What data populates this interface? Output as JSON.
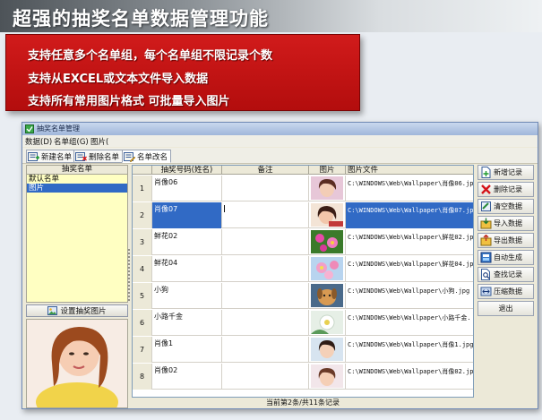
{
  "headline": "超强的抽奖名单数据管理功能",
  "promo": {
    "line1": "支持任意多个名单组，每个名单组不限记录个数",
    "line2": "支持从EXCEL或文本文件导入数据",
    "line3": "支持所有常用图片格式 可批量导入图片"
  },
  "window": {
    "title": "抽奖名单管理",
    "menu": [
      "数据(D)",
      "名单组(G)",
      "图片("
    ],
    "toolbar": {
      "new": "新建名单",
      "delete": "删除名单",
      "rename": "名单改名"
    }
  },
  "left_panel": {
    "header": "抽奖名单",
    "items": [
      "默认名单",
      "图片"
    ],
    "selected_index": 1,
    "set_photo_button": "设置抽奖图片"
  },
  "grid": {
    "columns": [
      "抽奖号码(姓名)",
      "备注",
      "图片",
      "图片文件"
    ],
    "rows": [
      {
        "num": "1",
        "name": "肖像06",
        "note": "",
        "file": "C:\\WINDOWS\\Web\\Wallpaper\\肖像06.jp"
      },
      {
        "num": "2",
        "name": "肖像07",
        "note": "",
        "file": "C:\\WINDOWS\\Web\\Wallpaper\\肖像07.jp"
      },
      {
        "num": "3",
        "name": "鲜花02",
        "note": "",
        "file": "C:\\WINDOWS\\Web\\Wallpaper\\鲜花02.jp"
      },
      {
        "num": "4",
        "name": "鲜花04",
        "note": "",
        "file": "C:\\WINDOWS\\Web\\Wallpaper\\鲜花04.jp"
      },
      {
        "num": "5",
        "name": "小狗",
        "note": "",
        "file": "C:\\WINDOWS\\Web\\Wallpaper\\小狗.jpg"
      },
      {
        "num": "6",
        "name": "小路千金",
        "note": "",
        "file": "C:\\WINDOWS\\Web\\Wallpaper\\小路千金."
      },
      {
        "num": "7",
        "name": "肖像1",
        "note": "",
        "file": "C:\\WINDOWS\\Web\\Wallpaper\\肖像1.jpg"
      },
      {
        "num": "8",
        "name": "肖像02",
        "note": "",
        "file": "C:\\WINDOWS\\Web\\Wallpaper\\肖像02.jp"
      }
    ],
    "selected_row": 2,
    "status": "当前第2条/共11条记录"
  },
  "actions": [
    "新增记录",
    "删除记录",
    "清空数据",
    "导入数据",
    "导出数据",
    "自动生成",
    "查找记录",
    "压缩数据",
    "退出"
  ],
  "colors": {
    "promo_red": "#c8141a",
    "selection_blue": "#316ac5",
    "list_yellow": "#ffffc2"
  },
  "icons": [
    "app-window-icon",
    "new-list-icon",
    "delete-list-icon",
    "rename-list-icon",
    "set-photo-icon",
    "add-record-icon",
    "delete-record-icon",
    "clear-data-icon",
    "import-data-icon",
    "export-data-icon",
    "auto-generate-icon",
    "find-record-icon",
    "compress-data-icon"
  ]
}
